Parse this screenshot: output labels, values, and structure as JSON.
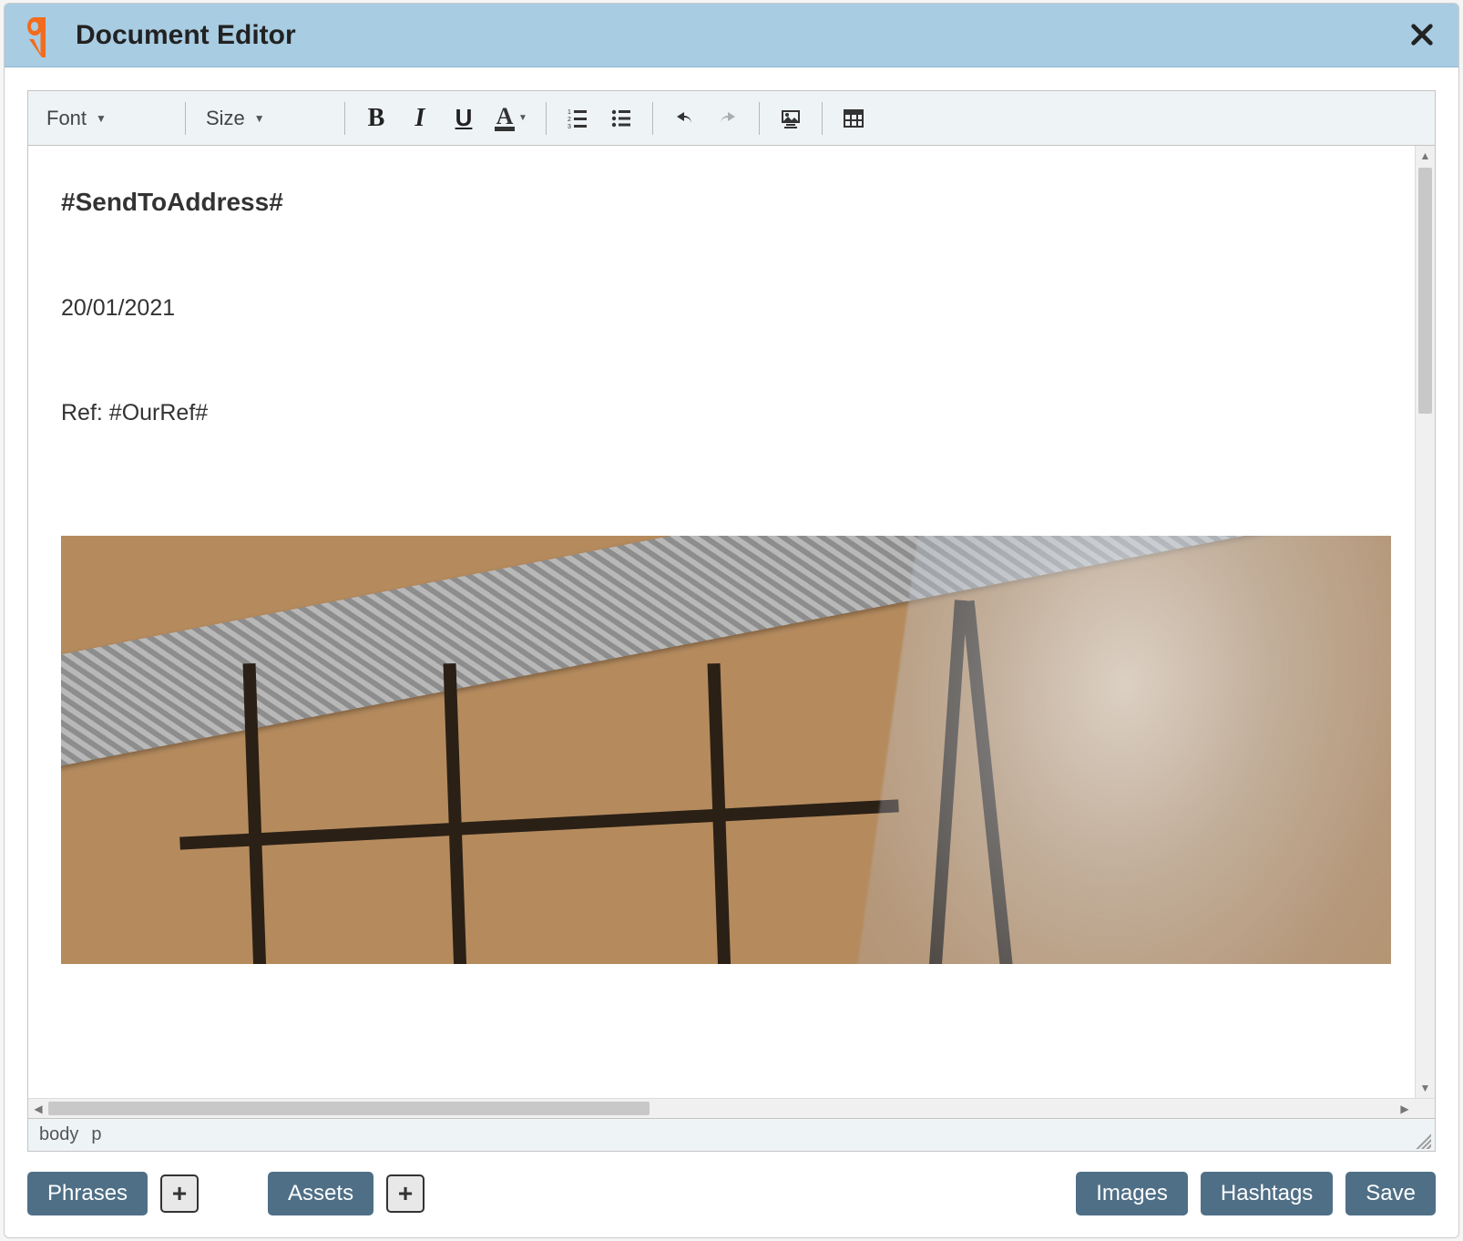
{
  "window": {
    "title": "Document Editor"
  },
  "toolbar": {
    "font_label": "Font",
    "size_label": "Size"
  },
  "document": {
    "address_placeholder": "#SendToAddress#",
    "date": "20/01/2021",
    "ref_line": "Ref: #OurRef#"
  },
  "path": {
    "segment1": "body",
    "segment2": "p"
  },
  "buttons": {
    "phrases": "Phrases",
    "assets": "Assets",
    "images": "Images",
    "hashtags": "Hashtags",
    "save": "Save"
  }
}
